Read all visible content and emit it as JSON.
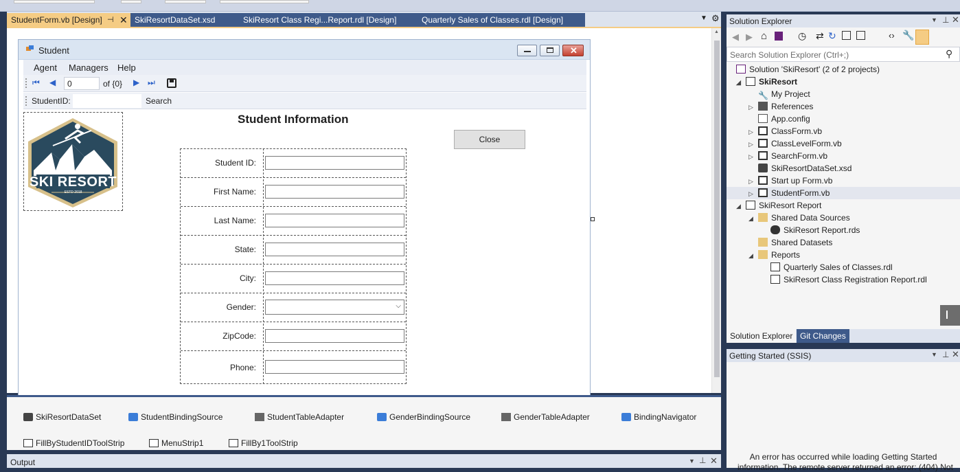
{
  "doc_tabs": [
    {
      "label": "StudentForm.vb [Design]",
      "active": true
    },
    {
      "label": "SkiResortDataSet.xsd",
      "active": false
    },
    {
      "label": "SkiResort Class Regi...Report.rdl [Design]",
      "active": false
    },
    {
      "label": "Quarterly Sales of Classes.rdl [Design]",
      "active": false
    }
  ],
  "form": {
    "title": "Student",
    "menu": [
      "Agent",
      "Managers",
      "Help"
    ],
    "navigator": {
      "position": "0",
      "count": "of {0}"
    },
    "search_label": "StudentID:",
    "search_button": "Search",
    "heading": "Student Information",
    "close_button": "Close",
    "logo": {
      "name": "SKI RESORT",
      "estd": "ESTD 2018"
    },
    "fields": [
      {
        "label": "Student ID:",
        "type": "text"
      },
      {
        "label": "First Name:",
        "type": "text"
      },
      {
        "label": "Last Name:",
        "type": "text"
      },
      {
        "label": "State:",
        "type": "text"
      },
      {
        "label": "City:",
        "type": "text"
      },
      {
        "label": "Gender:",
        "type": "combo"
      },
      {
        "label": "ZipCode:",
        "type": "text"
      },
      {
        "label": "Phone:",
        "type": "text"
      }
    ]
  },
  "tray": [
    "SkiResortDataSet",
    "StudentBindingSource",
    "StudentTableAdapter",
    "GenderBindingSource",
    "GenderTableAdapter",
    "BindingNavigator",
    "FillByStudentIDToolStrip",
    "MenuStrip1",
    "FillBy1ToolStrip"
  ],
  "output_title": "Output",
  "solution_explorer": {
    "title": "Solution Explorer",
    "search_placeholder": "Search Solution Explorer (Ctrl+;)",
    "nodes": [
      {
        "label": "Solution 'SkiResort' (2 of 2 projects)",
        "icon": "solution-icon"
      },
      {
        "label": "SkiResort",
        "icon": "vb-project-icon"
      },
      {
        "label": "My Project",
        "icon": "wrench-icon"
      },
      {
        "label": "References",
        "icon": "references-icon"
      },
      {
        "label": "App.config",
        "icon": "config-file-icon"
      },
      {
        "label": "ClassForm.vb",
        "icon": "form-file-icon"
      },
      {
        "label": "ClassLevelForm.vb",
        "icon": "form-file-icon"
      },
      {
        "label": "SearchForm.vb",
        "icon": "form-file-icon"
      },
      {
        "label": "SkiResortDataSet.xsd",
        "icon": "dataset-icon"
      },
      {
        "label": "Start up Form.vb",
        "icon": "form-file-icon"
      },
      {
        "label": "StudentForm.vb",
        "icon": "form-file-icon"
      },
      {
        "label": "SkiResort Report",
        "icon": "report-project-icon"
      },
      {
        "label": "Shared Data Sources",
        "icon": "folder-icon"
      },
      {
        "label": "SkiResort Report.rds",
        "icon": "datasource-icon"
      },
      {
        "label": "Shared Datasets",
        "icon": "folder-icon"
      },
      {
        "label": "Reports",
        "icon": "folder-icon"
      },
      {
        "label": "Quarterly Sales of Classes.rdl",
        "icon": "report-file-icon"
      },
      {
        "label": "SkiResort Class Registration Report.rdl",
        "icon": "report-file-icon"
      }
    ],
    "tabs": [
      "Solution Explorer",
      "Git Changes"
    ]
  },
  "getting_started": {
    "title": "Getting Started (SSIS)",
    "message_line1": "An error has occurred while loading Getting Started",
    "message_line2": "information. The remote server returned an error: (404) Not"
  },
  "colors": {
    "chrome": "#293955",
    "active_tab": "#f5cc84",
    "panel": "#f5f5f5"
  }
}
